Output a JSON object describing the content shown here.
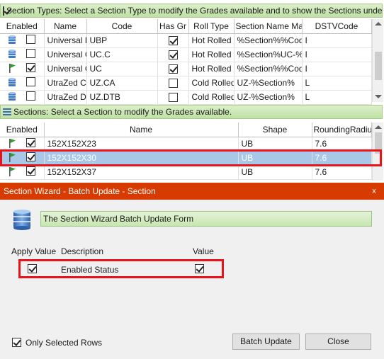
{
  "section_types": {
    "banner": "Section Types: Select a Section Type to modify the Grades available and to show the Sections under t...",
    "columns": [
      "Enabled",
      "Name",
      "Code",
      "Has Gr",
      "Roll Type",
      "Section Name Mas",
      "DSTVCode"
    ],
    "rows": [
      {
        "icon": "database-icon",
        "enabled": false,
        "name": "Universal B",
        "code": "UBP",
        "has_grades": true,
        "roll_type": "Hot Rolled",
        "mask": "%Section%%Cod",
        "dstv": "I"
      },
      {
        "icon": "database-icon",
        "enabled": false,
        "name": "Universal C",
        "code": "UC.C",
        "has_grades": true,
        "roll_type": "Hot Rolled",
        "mask": "%Section%UC-%",
        "dstv": "I"
      },
      {
        "icon": "green-flag-icon",
        "enabled": true,
        "name": "Universal C",
        "code": "UC",
        "has_grades": true,
        "roll_type": "Hot Rolled",
        "mask": "%Section%%Cod",
        "dstv": "I"
      },
      {
        "icon": "database-icon",
        "enabled": false,
        "name": "UtraZed Cle",
        "code": "UZ.CA",
        "has_grades": false,
        "roll_type": "Cold Rolled",
        "mask": "UZ-%Section%",
        "dstv": "L"
      },
      {
        "icon": "database-icon",
        "enabled": false,
        "name": "UtraZed Di",
        "code": "UZ.DTB",
        "has_grades": false,
        "roll_type": "Cold Rolled",
        "mask": "UZ-%Section%",
        "dstv": "L"
      }
    ]
  },
  "sections": {
    "banner": "Sections: Select a Section to modify the Grades available.",
    "columns": [
      "Enabled",
      "Name",
      "Shape",
      "RoundingRadiu"
    ],
    "rows": [
      {
        "icon": "green-flag-icon",
        "enabled": true,
        "name": "152X152X23",
        "shape": "UB",
        "radius": "7.6",
        "selected": false
      },
      {
        "icon": "green-flag-icon",
        "enabled": true,
        "name": "152X152X30",
        "shape": "UB",
        "radius": "7.6",
        "selected": true
      },
      {
        "icon": "green-flag-icon",
        "enabled": true,
        "name": "152X152X37",
        "shape": "UB",
        "radius": "7.6",
        "selected": false
      }
    ]
  },
  "dialog": {
    "title": "Section Wizard - Batch Update - Section",
    "close_label": "x",
    "form_label": "The Section Wizard Batch Update Form",
    "col_apply": "Apply Value",
    "col_description": "Description",
    "col_value": "Value",
    "row": {
      "apply": true,
      "description": "Enabled Status",
      "value": true
    },
    "only_selected_label": "Only Selected Rows",
    "only_selected": true,
    "batch_update_label": "Batch Update",
    "close_button_label": "Close"
  },
  "colors": {
    "title_bar": "#d83b01",
    "highlight": "#e8141a",
    "selection": "#a9c8e8",
    "band": "#c8e6b0"
  }
}
